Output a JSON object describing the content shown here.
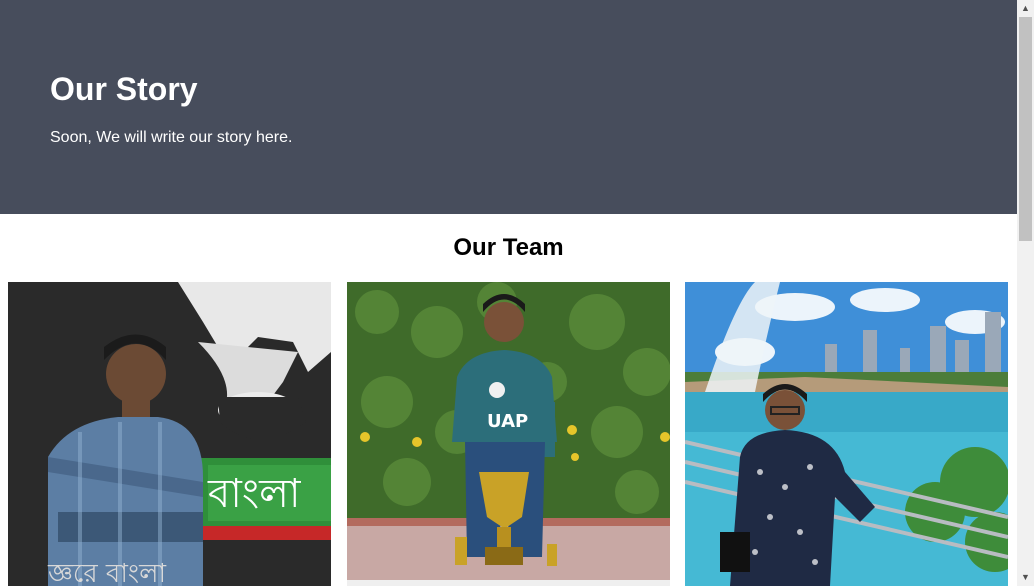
{
  "hero": {
    "title": "Our Story",
    "subtitle": "Soon, We will write our story here."
  },
  "team": {
    "title": "Our Team",
    "members": [
      {
        "photo": "team-member-photo-1",
        "sign_text": "বাংলা"
      },
      {
        "photo": "team-member-photo-2",
        "jersey_text": "UAP"
      },
      {
        "photo": "team-member-photo-3"
      }
    ]
  },
  "scrollbar": {
    "up_icon": "triangle-up-icon",
    "down_icon": "triangle-down-icon"
  },
  "colors": {
    "hero_bg": "#474d5c",
    "hero_text": "#ffffff",
    "page_bg": "#ffffff"
  }
}
